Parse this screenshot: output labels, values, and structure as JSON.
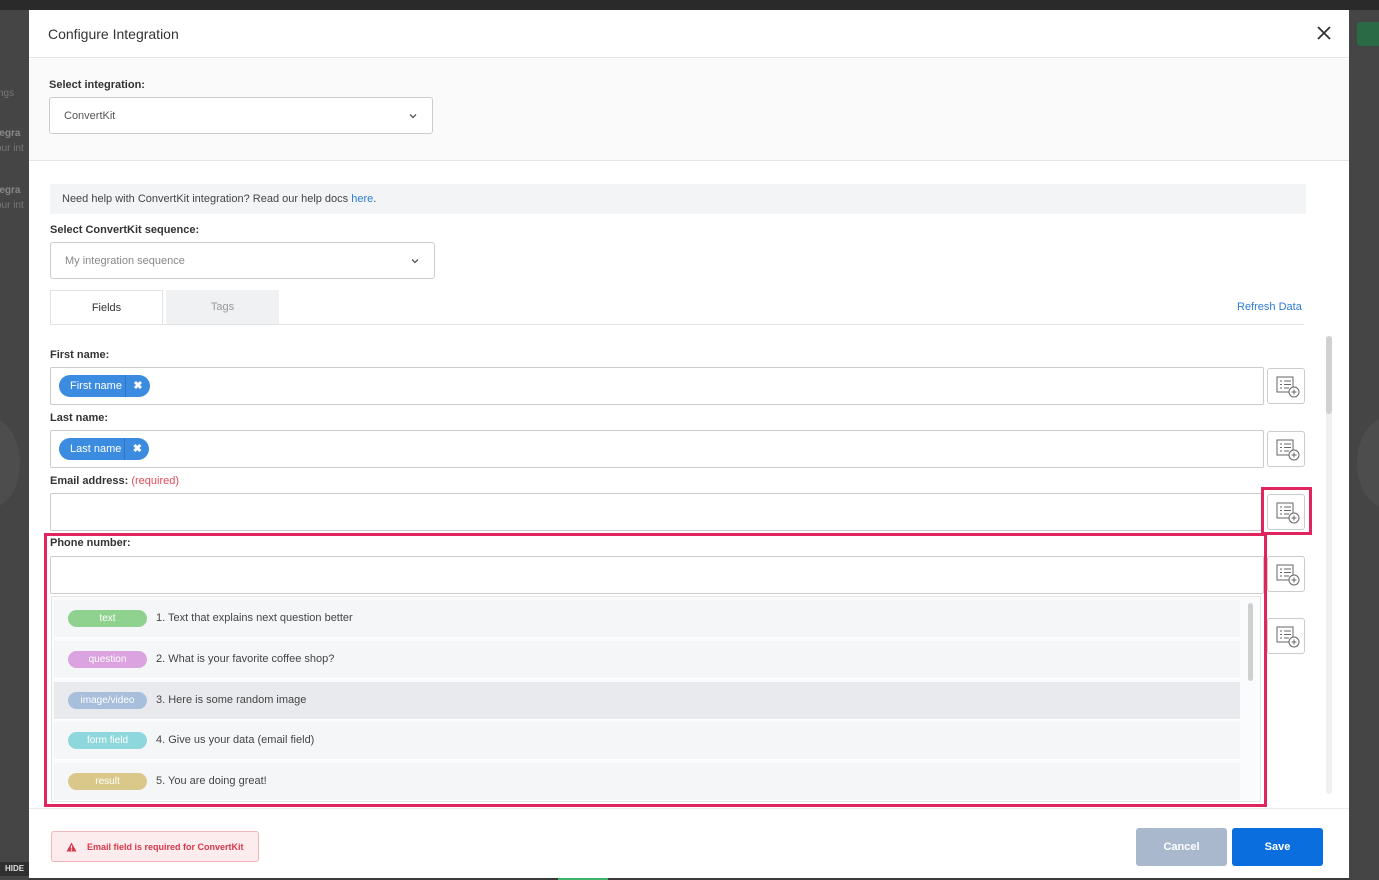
{
  "modal": {
    "title": "Configure Integration"
  },
  "integration": {
    "label": "Select integration:",
    "selected": "ConvertKit"
  },
  "help": {
    "text": "Need help with ConvertKit integration? Read our help docs ",
    "link": "here",
    "suffix": "."
  },
  "sequence": {
    "label": "Select ConvertKit sequence:",
    "placeholder": "My integration sequence"
  },
  "tabs": [
    {
      "label": "Fields",
      "active": true
    },
    {
      "label": "Tags",
      "active": false
    }
  ],
  "refresh_label": "Refresh Data",
  "fields": {
    "first_name": {
      "label": "First name:",
      "chip": "First name"
    },
    "last_name": {
      "label": "Last name:",
      "chip": "Last name"
    },
    "email": {
      "label": "Email address:",
      "required": "(required)"
    },
    "phone": {
      "label": "Phone number:"
    }
  },
  "dropdown": [
    {
      "tag": "text",
      "color": "#8fd18f",
      "text": "1. Text that explains next question better"
    },
    {
      "tag": "question",
      "color": "#dba3e0",
      "text": "2. What is your favorite coffee shop?"
    },
    {
      "tag": "image/video",
      "color": "#a8bfdc",
      "text": "3. Here is some random image"
    },
    {
      "tag": "form field",
      "color": "#8ed8dd",
      "text": "4. Give us your data (email field)"
    },
    {
      "tag": "result",
      "color": "#d9c88a",
      "text": "5. You are doing great!"
    }
  ],
  "footer": {
    "alert": "Email field is required for ConvertKit",
    "cancel": "Cancel",
    "save": "Save"
  },
  "background": {
    "hide_label": "HIDE",
    "left_texts": [
      "ngs",
      "tegra",
      "our int",
      "tegra",
      "our int"
    ]
  },
  "colors": {
    "primary": "#0a6ede",
    "chip": "#3b8be0",
    "highlight": "#e0245e",
    "error": "#d8384b"
  }
}
